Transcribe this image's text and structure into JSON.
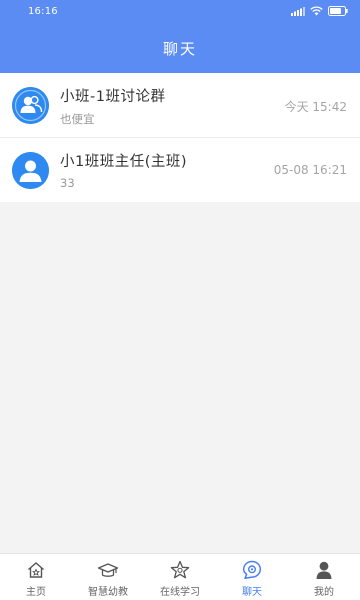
{
  "status_bar": {
    "time": "16:16"
  },
  "header": {
    "title": "聊天"
  },
  "chats": [
    {
      "name": "小班-1班讨论群",
      "preview": "也便宜",
      "time": "今天 15:42",
      "avatar_icon": "group-avatar-icon"
    },
    {
      "name": "小1班班主任(主班)",
      "preview": "33",
      "time": "05-08 16:21",
      "avatar_icon": "person-avatar-icon"
    }
  ],
  "tabbar": {
    "items": [
      {
        "label": "主页",
        "icon": "home-icon",
        "active": false
      },
      {
        "label": "智慧幼教",
        "icon": "graduation-cap-icon",
        "active": false
      },
      {
        "label": "在线学习",
        "icon": "star-icon",
        "active": false
      },
      {
        "label": "聊天",
        "icon": "chat-icon",
        "active": true
      },
      {
        "label": "我的",
        "icon": "user-icon",
        "active": false
      }
    ]
  },
  "colors": {
    "header_bg": "#5b8cf4",
    "avatar_bg": "#2e8af0",
    "active_tab": "#4a7ff0",
    "page_bg": "#f3f3f3"
  }
}
